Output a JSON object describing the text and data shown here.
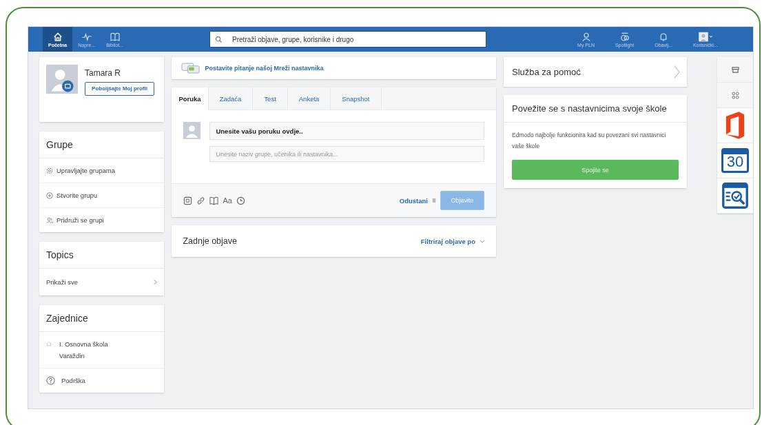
{
  "nav": [
    {
      "label": "Početna",
      "selected": true
    },
    {
      "label": "Napre...",
      "selected": false
    },
    {
      "label": "Bibliot...",
      "selected": false
    }
  ],
  "search": {
    "placeholder": "Pretraži objave, grupe, korisnike i drugo"
  },
  "nav_right": [
    {
      "label": "My PLN"
    },
    {
      "label": "Spotlight"
    },
    {
      "label": "Obavij..."
    },
    {
      "label": "Korisnički..."
    }
  ],
  "profile": {
    "name": "Tamara R",
    "button": "Poboljšajte Moj profil"
  },
  "groups": {
    "title": "Grupe",
    "items": [
      {
        "label": "Upravljajte grupama"
      },
      {
        "label": "Stvorite grupu"
      },
      {
        "label": "Pridruži se grupi"
      }
    ]
  },
  "topics": {
    "title": "Topics",
    "link": "Prikaži sve"
  },
  "communities": {
    "title": "Zajednice",
    "items": [
      {
        "label": "I. Osnovna škola Varaždin"
      },
      {
        "label": "Podrška"
      }
    ]
  },
  "ask": {
    "text": "Postavite pitanje našoj Mreži nastavnika"
  },
  "composer": {
    "tabs": [
      {
        "label": "Poruka",
        "selected": true
      },
      {
        "label": "Zadaća",
        "selected": false
      },
      {
        "label": "Test",
        "selected": false
      },
      {
        "label": "Anketa",
        "selected": false
      },
      {
        "label": "Snapshot",
        "selected": false
      }
    ],
    "message": {
      "value": "Unesite vašu poruku ovdje.."
    },
    "recipients": {
      "placeholder": "Unesite naziv grupe, učenika ili nastavnika..."
    },
    "format": "Aa",
    "cancel": "Odustani",
    "post": {
      "label": "Objavite",
      "disabled": true
    }
  },
  "feed": {
    "title": "Zadnje objave",
    "filter": "Filtriraj objave po"
  },
  "help": {
    "title": "Služba za pomoć"
  },
  "connect": {
    "title": "Povežite se s nastavnicima svoje škole",
    "text": "Edmodo najbolje funkcionira kad su povezani svi nastavnici vaše škole",
    "button": "Spojite se"
  },
  "rail": [
    {
      "kind": "store"
    },
    {
      "kind": "apps"
    },
    {
      "kind": "office"
    },
    {
      "kind": "calendar",
      "text": "30"
    },
    {
      "kind": "quiz"
    }
  ]
}
